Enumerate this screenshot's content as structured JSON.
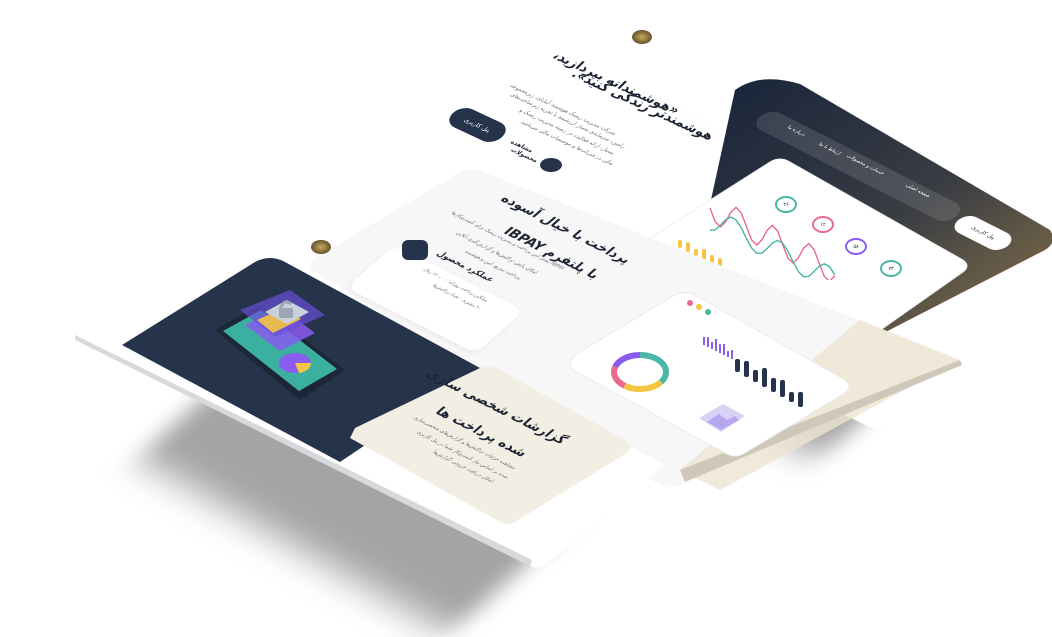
{
  "hero": {
    "headline": "«هوشمندانه بپردازید،",
    "headline2": "هوشمندتر زندگی کنید».",
    "description": "شرکت مدیریت ریسک هوشمند آیباپای، زیرمجموعه",
    "description2": "زامین، سرمایه‌ی بسیار ارزشمند با تجربه زیرساخت‌های",
    "description3": "بسیار، ارائه فعالیت در زمینه مدیریت ریسک و",
    "description4": "مالی در شرکت‌ها و موسسات مالی می‌باشد.",
    "primary_button": "پنل کاربری",
    "secondary_button": "مشاهده",
    "secondary_button2": "محصولات"
  },
  "nav": {
    "items": [
      "صفحه اصلی",
      "خدمات و محصولات",
      "ارتباط با ما",
      "درباره ما"
    ],
    "cta": "پنل کاربری"
  },
  "section_payment": {
    "title": "پرداخت با خیال آسوده",
    "title2": "با پلتفرم IBPAY",
    "body": "IBPAY بستر امن پرداخت و مدیریت ریسک برای کسب‌وکارها",
    "body2": "امکان پایش تراکنش‌ها و گزارش‌گیری آنلاین",
    "body3": "پرداخت سریع، امن و هوشمند"
  },
  "product_card": {
    "title": "عملکرد محصول",
    "line1": "میانگین پرداخت روزانه: ۱۲۰,۰۰۰ ریال",
    "line2": "۲۰ مشتری - تعداد تراکنش‌ها"
  },
  "section_reports": {
    "title": "گزارشات شخصی سازی",
    "title2": "شده پرداخت ها",
    "body": "مشاهده جزئیات تراکنش‌ها و گزارش‌های شخصی‌سازی",
    "body2": "شده بر اساس نیاز کسب‌وکار شما در پنل کاربری",
    "body3": "امکان دریافت خروجی گزارش‌ها"
  },
  "dashboard": {
    "kpis": [
      "۲۶",
      "۱۲",
      "۵۸",
      "۷۳"
    ],
    "bar_chart_values": [
      0.5,
      0.7,
      0.4,
      0.9,
      0.6,
      0.8,
      0.3,
      0.65
    ],
    "donut_segments": [
      0.35,
      0.25,
      0.2,
      0.2
    ]
  },
  "colors": {
    "navy": "#26344b",
    "gold": "#8a6d3b",
    "cream": "#f3eadb",
    "accent_teal": "#4bb6a5",
    "accent_pink": "#e96a8d",
    "accent_purple": "#8a5cf0",
    "accent_yellow": "#f4c542"
  },
  "icons": [
    "logo-icon",
    "play-icon",
    "lock-icon",
    "pie-chart-icon",
    "image-icon",
    "user-icon",
    "bell-icon"
  ]
}
